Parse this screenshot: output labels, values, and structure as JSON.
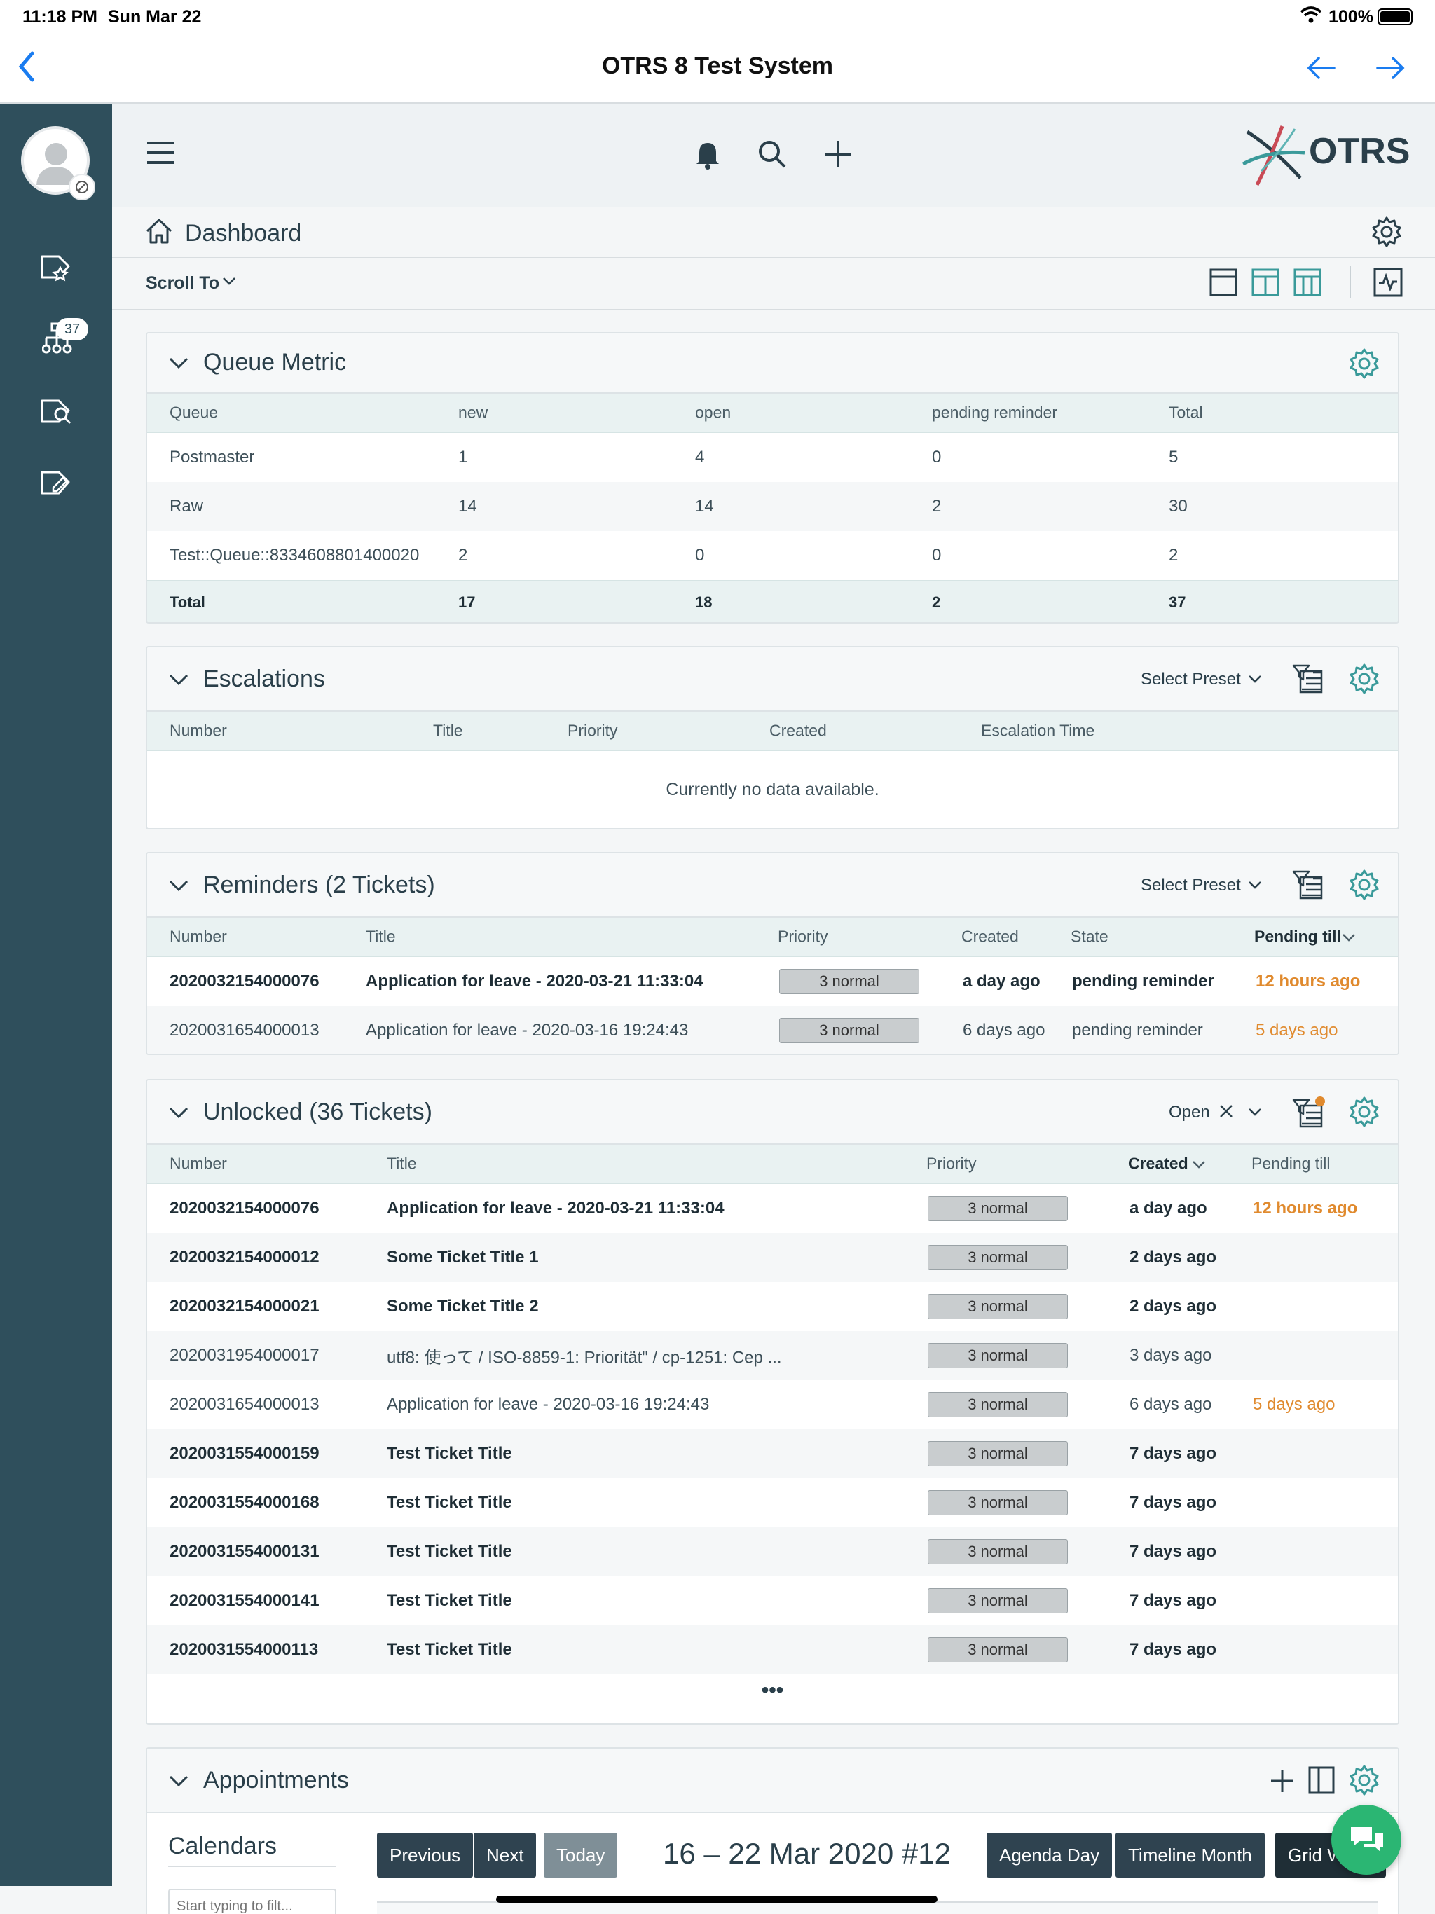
{
  "status": {
    "time": "11:18 PM",
    "date": "Sun Mar 22",
    "battery": "100%"
  },
  "nav": {
    "title": "OTRS 8 Test System"
  },
  "sidebar": {
    "badge_count": "37"
  },
  "header": {
    "logo_text": "OTRS",
    "breadcrumb": "Dashboard",
    "scroll_to": "Scroll To"
  },
  "queue_metric": {
    "title": "Queue Metric",
    "columns": [
      "Queue",
      "new",
      "open",
      "pending reminder",
      "Total"
    ],
    "rows": [
      [
        "Postmaster",
        "1",
        "4",
        "0",
        "5"
      ],
      [
        "Raw",
        "14",
        "14",
        "2",
        "30"
      ],
      [
        "Test::Queue::8334608801400020",
        "2",
        "0",
        "0",
        "2"
      ]
    ],
    "total": [
      "Total",
      "17",
      "18",
      "2",
      "37"
    ]
  },
  "escalations": {
    "title": "Escalations",
    "preset": "Select Preset",
    "columns": [
      "Number",
      "Title",
      "Priority",
      "Created",
      "Escalation Time"
    ],
    "empty": "Currently no data available."
  },
  "reminders": {
    "title": "Reminders (2 Tickets)",
    "preset": "Select Preset",
    "columns": [
      "Number",
      "Title",
      "Priority",
      "Created",
      "State",
      "Pending till"
    ],
    "rows": [
      {
        "number": "2020032154000076",
        "title": "Application for leave - 2020-03-21 11:33:04",
        "priority": "3 normal",
        "created": "a day ago",
        "state": "pending reminder",
        "pending": "12 hours ago"
      },
      {
        "number": "2020031654000013",
        "title": "Application for leave - 2020-03-16 19:24:43",
        "priority": "3 normal",
        "created": "6 days ago",
        "state": "pending reminder",
        "pending": "5 days ago"
      }
    ]
  },
  "unlocked": {
    "title": "Unlocked (36 Tickets)",
    "filter": "Open",
    "columns": [
      "Number",
      "Title",
      "Priority",
      "Created",
      "Pending till"
    ],
    "rows": [
      {
        "number": "2020032154000076",
        "title": "Application for leave - 2020-03-21 11:33:04",
        "priority": "3 normal",
        "created": "a day ago",
        "pending": "12 hours ago"
      },
      {
        "number": "2020032154000012",
        "title": "Some Ticket Title 1",
        "priority": "3 normal",
        "created": "2 days ago",
        "pending": ""
      },
      {
        "number": "2020032154000021",
        "title": "Some Ticket Title 2",
        "priority": "3 normal",
        "created": "2 days ago",
        "pending": ""
      },
      {
        "number": "2020031954000017",
        "title": "utf8: 使って / ISO-8859-1: Priorität\" / cp-1251: Сер ...",
        "priority": "3 normal",
        "created": "3 days ago",
        "pending": ""
      },
      {
        "number": "2020031654000013",
        "title": "Application for leave - 2020-03-16 19:24:43",
        "priority": "3 normal",
        "created": "6 days ago",
        "pending": "5 days ago"
      },
      {
        "number": "2020031554000159",
        "title": "Test Ticket Title",
        "priority": "3 normal",
        "created": "7 days ago",
        "pending": ""
      },
      {
        "number": "2020031554000168",
        "title": "Test Ticket Title",
        "priority": "3 normal",
        "created": "7 days ago",
        "pending": ""
      },
      {
        "number": "2020031554000131",
        "title": "Test Ticket Title",
        "priority": "3 normal",
        "created": "7 days ago",
        "pending": ""
      },
      {
        "number": "2020031554000141",
        "title": "Test Ticket Title",
        "priority": "3 normal",
        "created": "7 days ago",
        "pending": ""
      },
      {
        "number": "2020031554000113",
        "title": "Test Ticket Title",
        "priority": "3 normal",
        "created": "7 days ago",
        "pending": ""
      }
    ],
    "more": "•••"
  },
  "appointments": {
    "title": "Appointments",
    "calendars_label": "Calendars",
    "filter_placeholder": "Start typing to filt...",
    "buttons": {
      "previous": "Previous",
      "next": "Next",
      "today": "Today",
      "agenda_day": "Agenda Day",
      "timeline_month": "Timeline Month",
      "grid_week": "Grid Week"
    },
    "range": "16 – 22 Mar 2020 #12"
  },
  "colors": {
    "sidebar": "#2f4f5c",
    "accent": "#3a9a9a",
    "ios_blue": "#1a7cf0",
    "warning": "#e08a2e",
    "fab": "#2bb673"
  }
}
